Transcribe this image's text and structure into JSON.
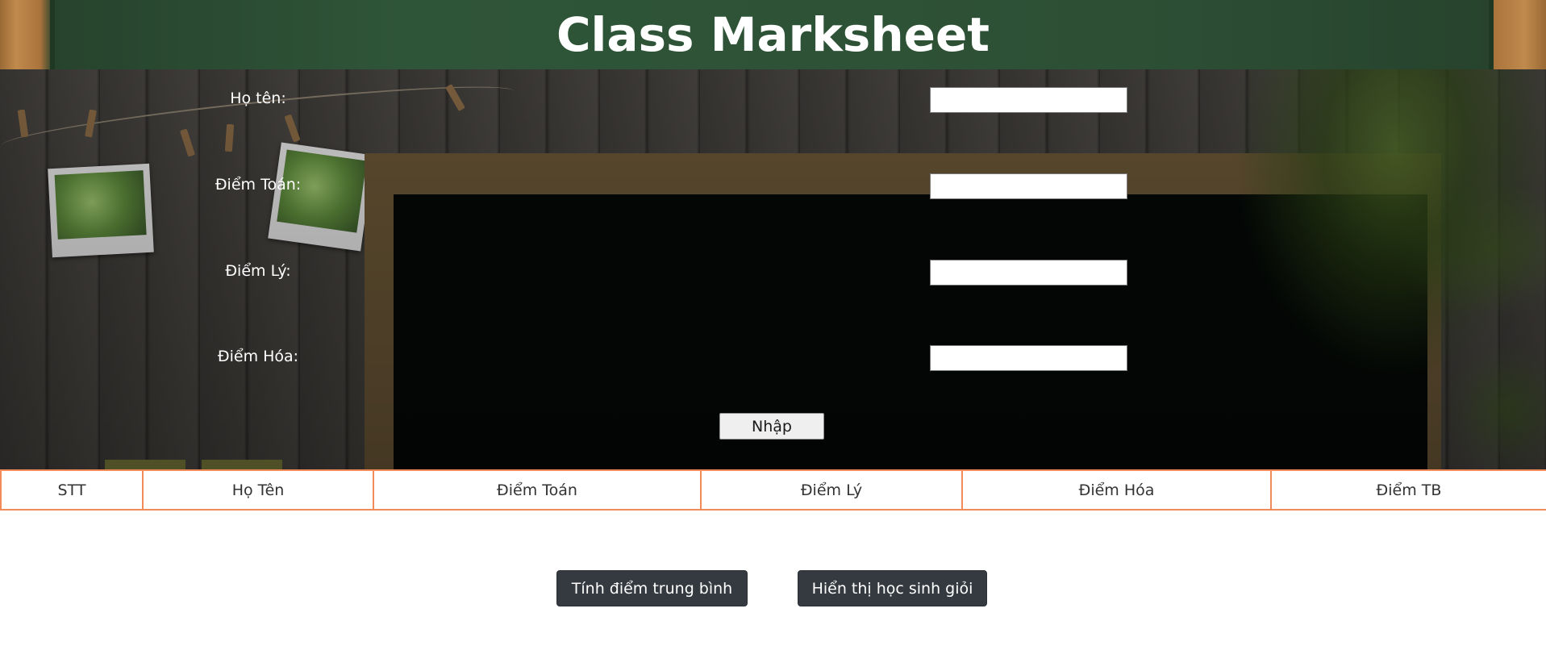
{
  "header": {
    "title": "Class Marksheet"
  },
  "form": {
    "fields": [
      {
        "label": "Họ tên:",
        "value": ""
      },
      {
        "label": "Điểm Toán:",
        "value": ""
      },
      {
        "label": "Điểm Lý:",
        "value": ""
      },
      {
        "label": "Điểm Hóa:",
        "value": ""
      }
    ],
    "submit_label": "Nhập"
  },
  "table": {
    "columns": [
      "STT",
      "Họ Tên",
      "Điểm Toán",
      "Điểm Lý",
      "Điểm Hóa",
      "Điểm TB"
    ]
  },
  "actions": {
    "average_label": "Tính điểm trung bình",
    "excellent_label": "Hiển thị học sinh giỏi"
  },
  "colors": {
    "header_green": "#2f5538",
    "table_border": "#f28b5a",
    "button_dark": "#343a40"
  }
}
